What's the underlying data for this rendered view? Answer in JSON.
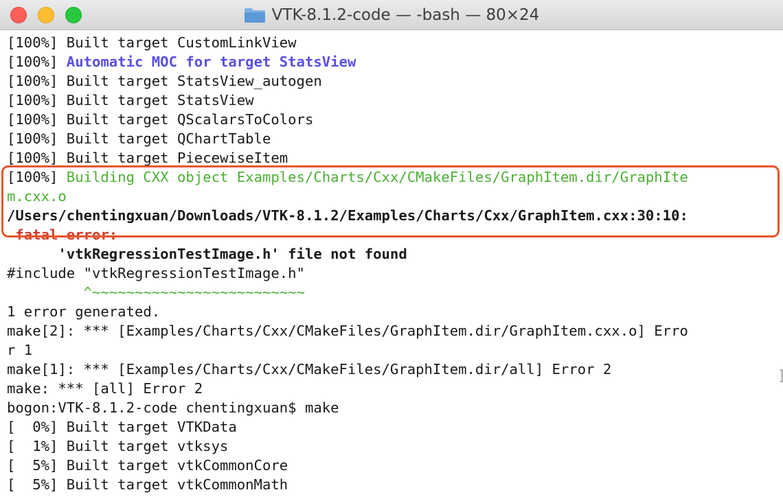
{
  "window": {
    "title": "VTK-8.1.2-code — -bash — 80×24",
    "folder_icon": "folder-icon",
    "traffic_lights": {
      "close": "#fe5f57",
      "minimize": "#febc2e",
      "maximize": "#28c840"
    }
  },
  "terminal": {
    "lines": [
      {
        "segments": [
          {
            "text": "[100%] Built target CustomLinkView"
          }
        ]
      },
      {
        "segments": [
          {
            "text": "[100%] "
          },
          {
            "text": "Automatic MOC for target StatsView",
            "style": "purple"
          }
        ]
      },
      {
        "segments": [
          {
            "text": "[100%] Built target StatsView_autogen"
          }
        ]
      },
      {
        "segments": [
          {
            "text": "[100%] Built target StatsView"
          }
        ]
      },
      {
        "segments": [
          {
            "text": "[100%] Built target QScalarsToColors"
          }
        ]
      },
      {
        "segments": [
          {
            "text": "[100%] Built target QChartTable"
          }
        ]
      },
      {
        "segments": [
          {
            "text": "[100%] Built target PiecewiseItem"
          }
        ]
      },
      {
        "segments": [
          {
            "text": "[100%] "
          },
          {
            "text": "Building CXX object Examples/Charts/Cxx/CMakeFiles/GraphItem.dir/GraphIte",
            "style": "green"
          }
        ]
      },
      {
        "segments": [
          {
            "text": "m.cxx.o",
            "style": "green"
          }
        ]
      },
      {
        "segments": [
          {
            "text": "/Users/chentingxuan/Downloads/VTK-8.1.2/Examples/Charts/Cxx/GraphItem.cxx:30:10:",
            "style": "bold"
          }
        ]
      },
      {
        "segments": [
          {
            "text": " "
          },
          {
            "text": "fatal error:",
            "style": "red"
          }
        ]
      },
      {
        "segments": [
          {
            "text": "      'vtkRegressionTestImage.h' file not found",
            "style": "bold"
          }
        ]
      },
      {
        "segments": [
          {
            "text": "#include \"vtkRegressionTestImage.h\""
          }
        ]
      },
      {
        "segments": [
          {
            "text": "         ^~~~~~~~~~~~~~~~~~~~~~~~~~",
            "style": "green"
          }
        ]
      },
      {
        "segments": [
          {
            "text": "1 error generated."
          }
        ]
      },
      {
        "segments": [
          {
            "text": "make[2]: *** [Examples/Charts/Cxx/CMakeFiles/GraphItem.dir/GraphItem.cxx.o] Erro"
          }
        ]
      },
      {
        "segments": [
          {
            "text": "r 1"
          }
        ]
      },
      {
        "segments": [
          {
            "text": "make[1]: *** [Examples/Charts/Cxx/CMakeFiles/GraphItem.dir/all] Error 2"
          }
        ]
      },
      {
        "segments": [
          {
            "text": "make: *** [all] Error 2"
          }
        ]
      },
      {
        "segments": [
          {
            "text": "bogon:VTK-8.1.2-code chentingxuan$ make"
          }
        ]
      },
      {
        "segments": [
          {
            "text": "[  0%] Built target VTKData"
          }
        ]
      },
      {
        "segments": [
          {
            "text": "[  1%] Built target vtksys"
          }
        ]
      },
      {
        "segments": [
          {
            "text": "[  5%] Built target vtkCommonCore"
          }
        ]
      },
      {
        "segments": [
          {
            "text": "[  5%] Built target vtkCommonMath"
          }
        ]
      }
    ],
    "highlight_color": "#e8562a"
  }
}
